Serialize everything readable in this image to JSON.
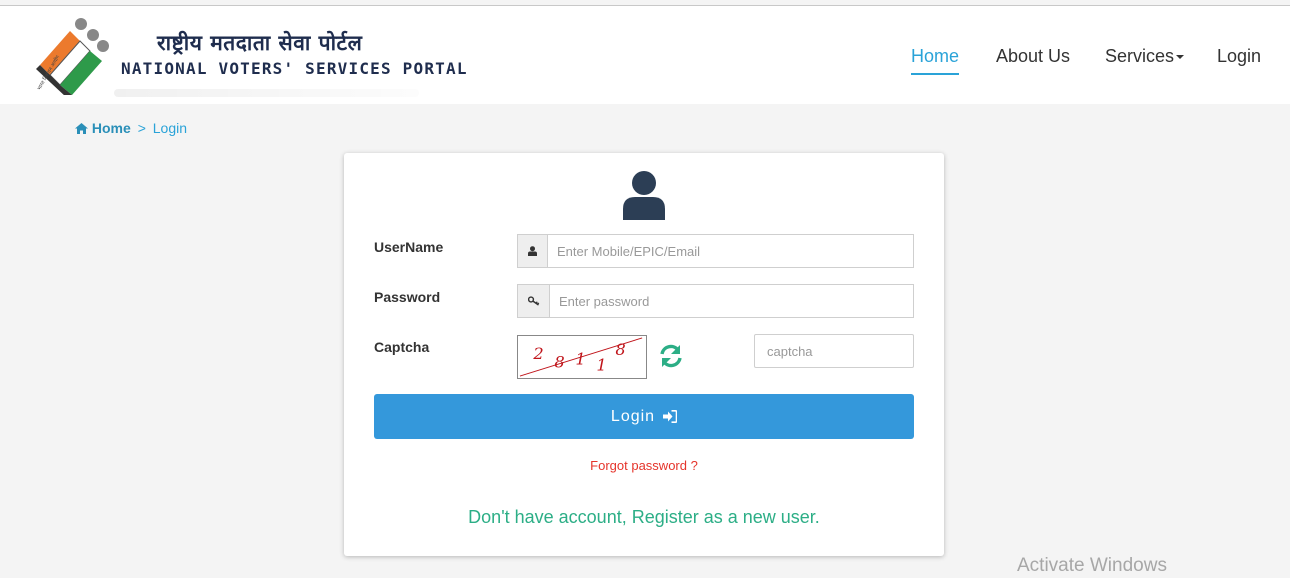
{
  "brand": {
    "hindi_title": "राष्ट्रीय मतदाता सेवा पोर्टल",
    "english_title": "NATIONAL VOTERS' SERVICES PORTAL"
  },
  "nav": {
    "items": [
      "Home",
      "About Us",
      "Services",
      "Login"
    ],
    "active": "Home"
  },
  "breadcrumb": {
    "home": "Home",
    "separator": ">",
    "current": "Login"
  },
  "login_form": {
    "username_label": "UserName",
    "username_placeholder": "Enter Mobile/EPIC/Email",
    "password_label": "Password",
    "password_placeholder": "Enter password",
    "captcha_label": "Captcha",
    "captcha_text": "28118",
    "captcha_placeholder": "captcha",
    "login_button": "Login",
    "forgot_password": "Forgot password ?",
    "register_link": "Don't have account, Register as a new user."
  },
  "watermark": "Activate Windows",
  "colors": {
    "accent": "#2aa3d8",
    "button": "#3498db",
    "danger": "#e5342b",
    "success": "#2cae86",
    "brand_text": "#1f2d4e"
  }
}
